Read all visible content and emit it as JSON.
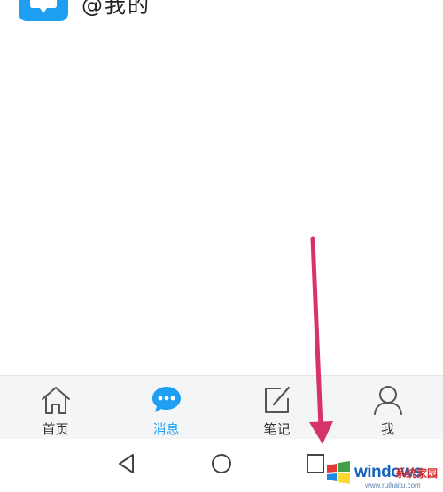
{
  "list": {
    "item_title": "@我的",
    "item_icon": "chat-bubble-icon"
  },
  "tabbar": {
    "items": [
      {
        "label": "首页",
        "icon": "home-icon"
      },
      {
        "label": "消息",
        "icon": "message-icon",
        "active": true
      },
      {
        "label": "笔记",
        "icon": "note-edit-icon"
      },
      {
        "label": "我",
        "icon": "person-icon"
      }
    ],
    "active_color": "#1e9ff2"
  },
  "navbar": {
    "buttons": [
      "back-icon",
      "home-circle-icon",
      "recents-icon"
    ]
  },
  "annotation": {
    "arrow_color": "#d6336c"
  },
  "watermark": {
    "brand": "windows",
    "cn": "系统家园",
    "url": "www.ruihaitu.com"
  }
}
